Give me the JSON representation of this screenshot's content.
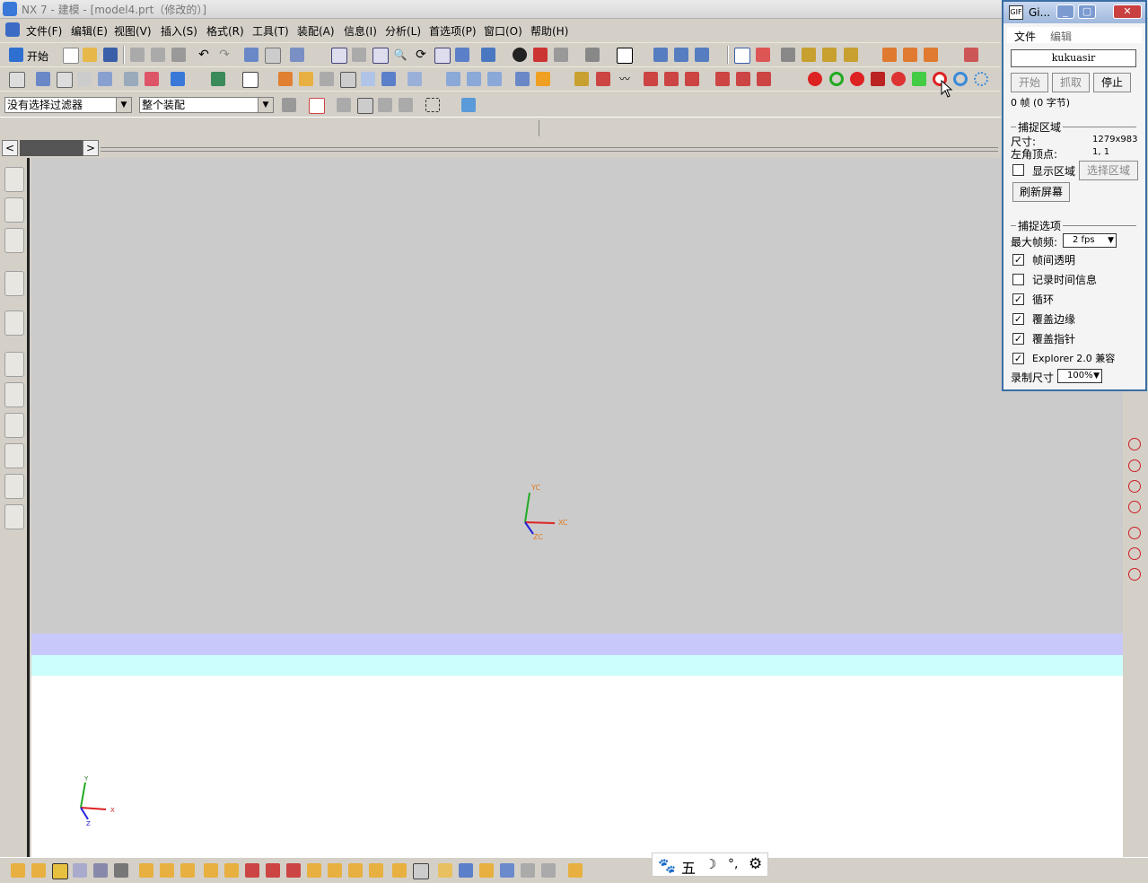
{
  "window": {
    "title": "NX 7 - 建模 - [model4.prt（修改的）]"
  },
  "menu": [
    "文件(F)",
    "编辑(E)",
    "视图(V)",
    "插入(S)",
    "格式(R)",
    "工具(T)",
    "装配(A)",
    "信息(I)",
    "分析(L)",
    "首选项(P)",
    "窗口(O)",
    "帮助(H)"
  ],
  "toolbar": {
    "start_label": "开始"
  },
  "filters": {
    "selection_filter": "没有选择过滤器",
    "assembly_scope": "整个装配"
  },
  "graphics": {
    "wcs_labels": {
      "xc": "XC",
      "yc": "YC",
      "zc": "ZC"
    },
    "abs_labels": {
      "x": "X",
      "y": "Y",
      "z": "Z"
    }
  },
  "ime": {
    "mode_char": "五"
  },
  "gif_tool": {
    "title": "Gi...",
    "menu": [
      "文件",
      "编辑"
    ],
    "user": "kukuasir",
    "buttons": {
      "start": "开始",
      "grab": "抓取",
      "stop": "停止"
    },
    "frames": "0 帧 (0 字节)",
    "capture_area": {
      "heading": "捕捉区域",
      "size_label": "尺寸:",
      "size_value": "1279x983",
      "corner_label": "左角顶点:",
      "corner_value": "1, 1",
      "show_area": "显示区域",
      "select_area": "选择区域",
      "refresh": "刷新屏幕"
    },
    "capture_options": {
      "heading": "捕捉选项",
      "max_fps_label": "最大帧频:",
      "max_fps_value": "2 fps",
      "options": [
        {
          "label": "帧间透明",
          "checked": true
        },
        {
          "label": "记录时间信息",
          "checked": false
        },
        {
          "label": "循环",
          "checked": true
        },
        {
          "label": "覆盖边缘",
          "checked": true
        },
        {
          "label": "覆盖指针",
          "checked": true
        },
        {
          "label": "Explorer 2.0 兼容",
          "checked": true
        }
      ],
      "record_size_label": "录制尺寸",
      "record_size_value": "100%"
    }
  },
  "colors": {
    "graphics_bg": "#cbcbcb",
    "band1": "#c8c8fb",
    "band2": "#ccfefe",
    "gif_border": "#3a6ea5"
  }
}
